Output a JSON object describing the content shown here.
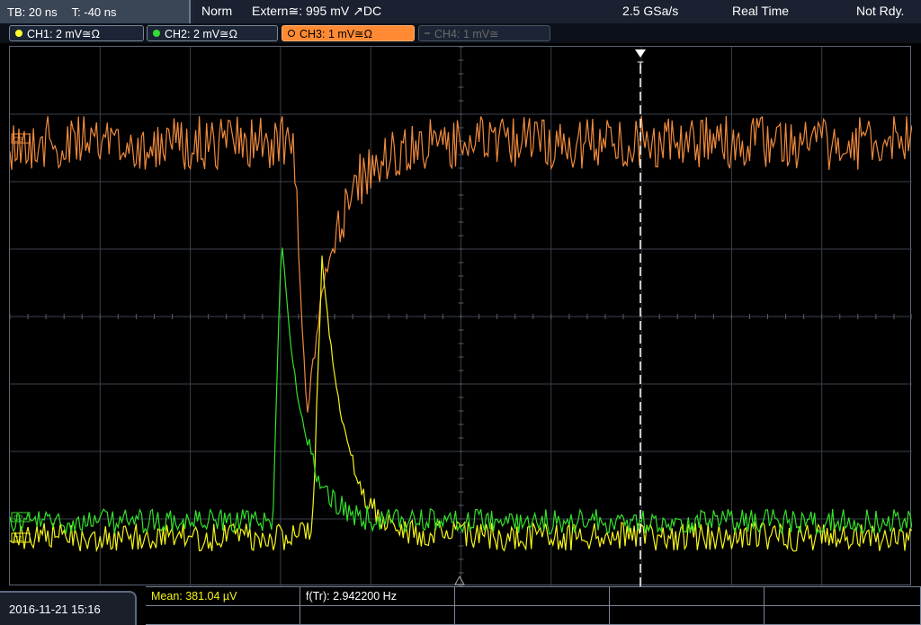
{
  "status": {
    "timebase": "TB: 20 ns",
    "trigger_pos": "T: -40 ns",
    "mode": "Norm",
    "trigger": "Extern≅: 995 mV ↗DC",
    "sample_rate": "2.5 GSa/s",
    "acq": "Real Time",
    "ready": "Not Rdy."
  },
  "channels": [
    {
      "label": "CH1: 2 mV≅Ω",
      "color": "#ffff33",
      "active": false
    },
    {
      "label": "CH2: 2 mV≅Ω",
      "color": "#33dd33",
      "active": false
    },
    {
      "label": "CH3: 1 mV≅Ω",
      "color": "#ff8a33",
      "active": true
    },
    {
      "label": "CH4: 1 mV≅",
      "color": "#666666",
      "active": false
    }
  ],
  "colors": {
    "ch1": "#f4f41a",
    "ch2": "#33e02a",
    "ch3": "#f08a3c",
    "grid": "#3a3f4a",
    "trigger_marker": "#ffffff"
  },
  "trigger_marker_label": "T",
  "ref_markers": [
    "C3",
    "C2",
    "C1"
  ],
  "footer": {
    "datetime": "2016-11-21 15:16",
    "measurement_1": "Mean: 381.04 µV",
    "measurement_2": "f(Tr): 2.942200 Hz"
  }
}
